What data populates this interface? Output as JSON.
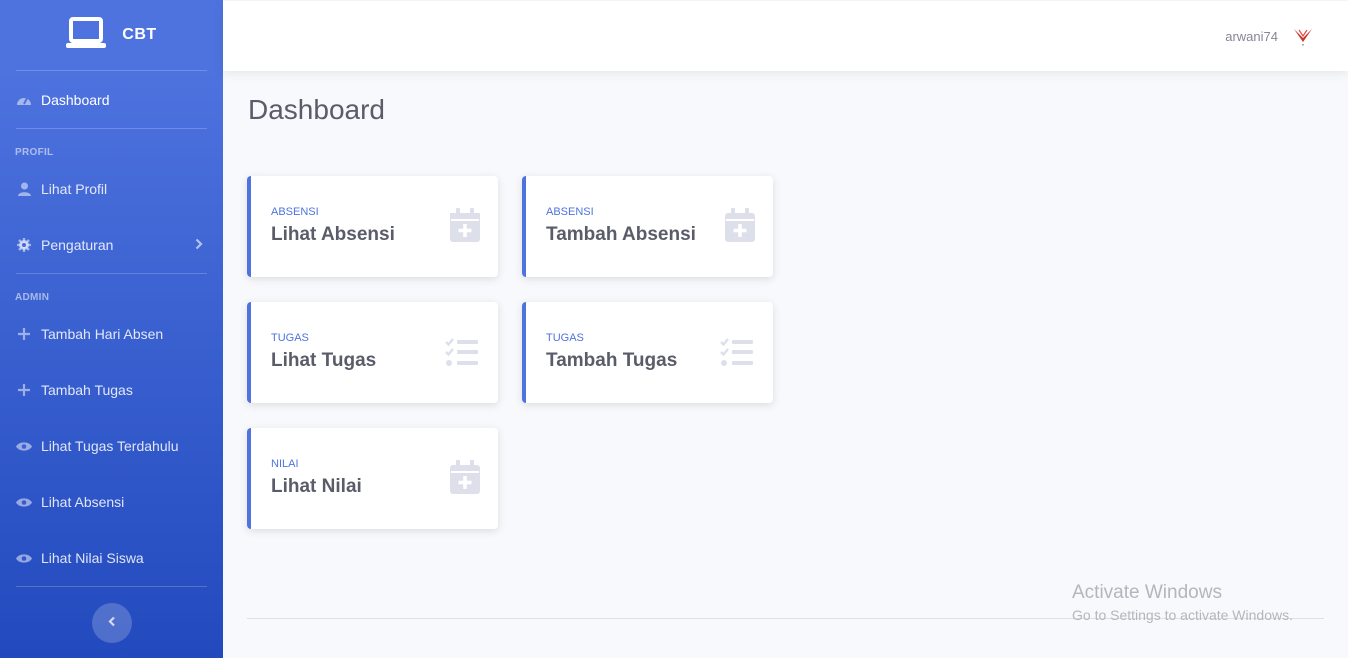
{
  "brand": {
    "name": "CBT",
    "icon": "laptop-icon"
  },
  "sidebar": {
    "dashboard": {
      "label": "Dashboard",
      "icon": "tachometer-icon"
    },
    "heading_profil": "PROFIL",
    "profil_items": [
      {
        "label": "Lihat Profil",
        "icon": "user-icon"
      },
      {
        "label": "Pengaturan",
        "icon": "gear-icon"
      }
    ],
    "heading_admin": "ADMIN",
    "admin_items": [
      {
        "label": "Tambah Hari Absen",
        "icon": "plus-icon"
      },
      {
        "label": "Tambah Tugas",
        "icon": "plus-icon"
      },
      {
        "label": "Lihat Tugas Terdahulu",
        "icon": "eye-icon"
      },
      {
        "label": "Lihat Absensi",
        "icon": "eye-icon"
      },
      {
        "label": "Lihat Nilai Siswa",
        "icon": "eye-icon"
      }
    ]
  },
  "topbar": {
    "username": "arwani74",
    "avatar": "avatar-logo"
  },
  "page": {
    "title": "Dashboard"
  },
  "cards": [
    {
      "category": "ABSENSI",
      "title": "Lihat Absensi",
      "icon": "calendar-plus-icon"
    },
    {
      "category": "ABSENSI",
      "title": "Tambah Absensi",
      "icon": "calendar-plus-icon"
    },
    {
      "category": "TUGAS",
      "title": "Lihat Tugas",
      "icon": "tasks-icon"
    },
    {
      "category": "TUGAS",
      "title": "Tambah Tugas",
      "icon": "tasks-icon"
    },
    {
      "category": "NILAI",
      "title": "Lihat Nilai",
      "icon": "calendar-plus-icon"
    }
  ],
  "watermark": {
    "line1": "Activate Windows",
    "line2": "Go to Settings to activate Windows."
  },
  "colors": {
    "primary": "#4e73df",
    "primary_dark": "#224abe",
    "text": "#5a5c69",
    "icon_muted": "#dddfeb"
  }
}
